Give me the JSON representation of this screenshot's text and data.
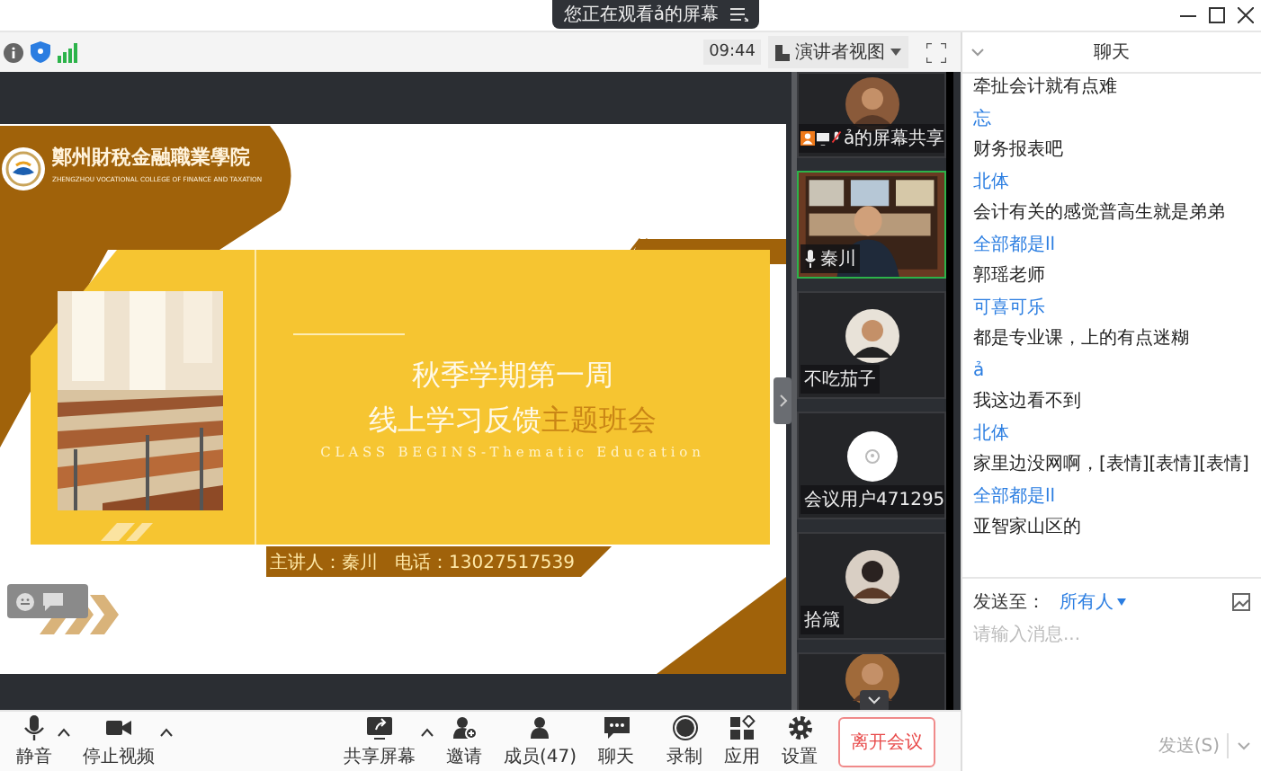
{
  "banner": {
    "text": "您正在观看ả的屏幕"
  },
  "toolbar": {
    "time": "09:44",
    "view_label": "演讲者视图"
  },
  "slide": {
    "college_name": "鄭州財稅金融職業學院",
    "college_name_en": "ZHENGZHOU VOCATIONAL COLLEGE OF FINANCE AND TAXATION",
    "title": "秋季学期第一周",
    "subtitle_parts": [
      {
        "text": "线上学习反馈",
        "highlight": false
      },
      {
        "text": "主题班会",
        "highlight": true
      }
    ],
    "tagline": "CLASS BEGINS-Thematic Education",
    "presenter": "主讲人：秦川   电话：13027517539"
  },
  "participants": [
    {
      "kind": "screen-share",
      "name": "ả的屏幕共享",
      "active": false
    },
    {
      "kind": "video",
      "name": "秦川",
      "active": true
    },
    {
      "kind": "avatar",
      "name": "不吃茄子",
      "active": false
    },
    {
      "kind": "default",
      "name": "会议用户471295",
      "active": false
    },
    {
      "kind": "avatar",
      "name": "拾箴",
      "active": false
    },
    {
      "kind": "partial",
      "active": false
    }
  ],
  "controls": [
    {
      "kind": "mic",
      "label": "静音",
      "menu": true
    },
    {
      "kind": "camera",
      "label": "停止视频",
      "menu": true
    },
    {
      "kind": "share",
      "label": "共享屏幕",
      "menu": true
    },
    {
      "kind": "invite",
      "label": "邀请",
      "menu": false
    },
    {
      "kind": "members",
      "label": "成员(47)",
      "menu": false
    },
    {
      "kind": "chat",
      "label": "聊天",
      "menu": false
    },
    {
      "kind": "record",
      "label": "录制",
      "menu": false
    },
    {
      "kind": "apps",
      "label": "应用",
      "menu": false
    },
    {
      "kind": "settings",
      "label": "设置",
      "menu": false
    }
  ],
  "leave_button": "离开会议",
  "chat": {
    "title": "聊天",
    "messages": [
      {
        "kind": "text",
        "text": "牵扯会计就有点难"
      },
      {
        "kind": "sender",
        "text": "忘"
      },
      {
        "kind": "text",
        "text": "财务报表吧"
      },
      {
        "kind": "sender",
        "text": "北体"
      },
      {
        "kind": "text",
        "text": "会计有关的感觉普高生就是弟弟"
      },
      {
        "kind": "sender",
        "text": "全部都是ll"
      },
      {
        "kind": "text",
        "text": "郭瑶老师"
      },
      {
        "kind": "sender",
        "text": "可喜可乐"
      },
      {
        "kind": "text",
        "text": "都是专业课，上的有点迷糊"
      },
      {
        "kind": "sender",
        "text": "ả"
      },
      {
        "kind": "text",
        "text": "我这边看不到"
      },
      {
        "kind": "sender",
        "text": "北体"
      },
      {
        "kind": "text",
        "text": "家里边没网啊，[表情][表情][表情]"
      },
      {
        "kind": "sender",
        "text": "全部都是ll"
      },
      {
        "kind": "text",
        "text": "亚智家山区的"
      }
    ],
    "send_to_label": "发送至：",
    "recipient": "所有人",
    "placeholder": "请输入消息...",
    "send_button": {
      "label": "发送(S)",
      "disabled": true
    }
  }
}
